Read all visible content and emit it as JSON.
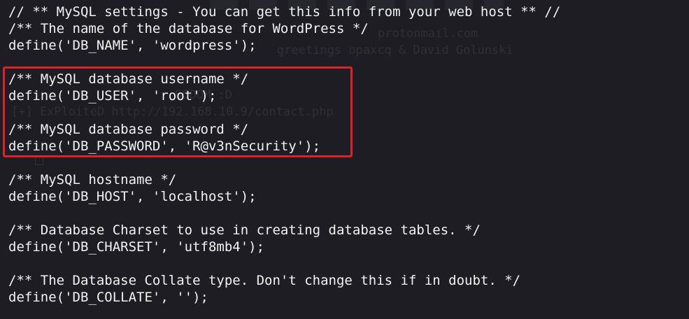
{
  "code_lines": [
    "// ** MySQL settings - You can get this info from your web host ** //",
    "/** The name of the database for WordPress */",
    "define('DB_NAME', 'wordpress');",
    "",
    "/** MySQL database username */",
    "define('DB_USER', 'root');",
    "",
    "/** MySQL database password */",
    "define('DB_PASSWORD', 'R@v3nSecurity');",
    "",
    "/** MySQL hostname */",
    "define('DB_HOST', 'localhost');",
    "",
    "/** Database Charset to use in creating database tables. */",
    "define('DB_CHARSET', 'utf8mb4');",
    "",
    "/** The Database Collate type. Don't change this if in doubt. */",
    "define('DB_COLLATE', '');"
  ],
  "background_ghost_text": [
    "protonmail.com",
    "greetings opaxcq & David Golunski",
    "BOOOM :D",
    "[+] ExPloiteD http://192.168.10.9/contact.php"
  ],
  "colors": {
    "background": "#1d1d23",
    "text": "#f2f2f2",
    "highlight": "#e0202a"
  }
}
